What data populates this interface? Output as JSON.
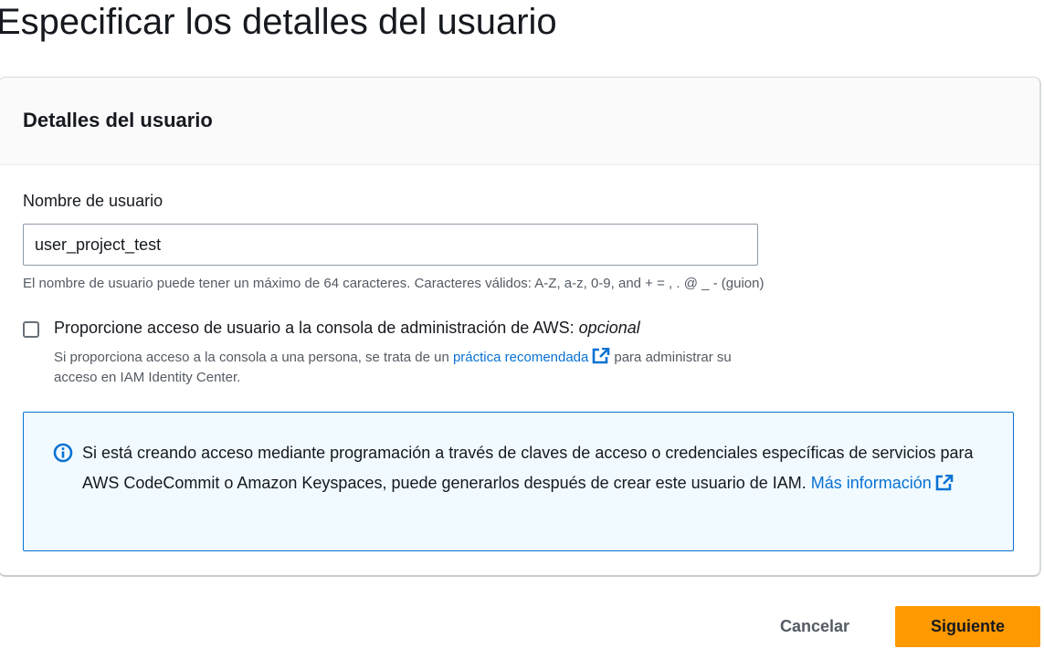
{
  "page": {
    "title": "Especificar los detalles del usuario"
  },
  "panel": {
    "header": "Detalles del usuario",
    "username": {
      "label": "Nombre de usuario",
      "value": "user_project_test",
      "constraint": "El nombre de usuario puede tener un máximo de 64 caracteres. Caracteres válidos: A-Z, a-z, 0-9, and + = , . @ _ - (guion)"
    },
    "console_access": {
      "checked": false,
      "label": "Proporcione acceso de usuario a la consola de administración de AWS:",
      "label_optional": "opcional",
      "desc_before": "Si proporciona acceso a la consola a una persona, se trata de un",
      "desc_link": "práctica recomendada",
      "desc_after": "para administrar su acceso en IAM Identity Center."
    },
    "info": {
      "text": "Si está creando acceso mediante programación a través de claves de acceso o credenciales específicas de servicios para AWS CodeCommit o Amazon Keyspaces, puede generarlos después de crear este usuario de IAM.",
      "link": "Más información",
      "icon": "info-icon",
      "link_icon": "external-link-icon"
    }
  },
  "actions": {
    "cancel": "Cancelar",
    "next": "Siguiente"
  },
  "colors": {
    "primary_button": "#ff9900",
    "link": "#0972d3",
    "info_background": "#f1faff",
    "info_border": "#0972d3"
  }
}
